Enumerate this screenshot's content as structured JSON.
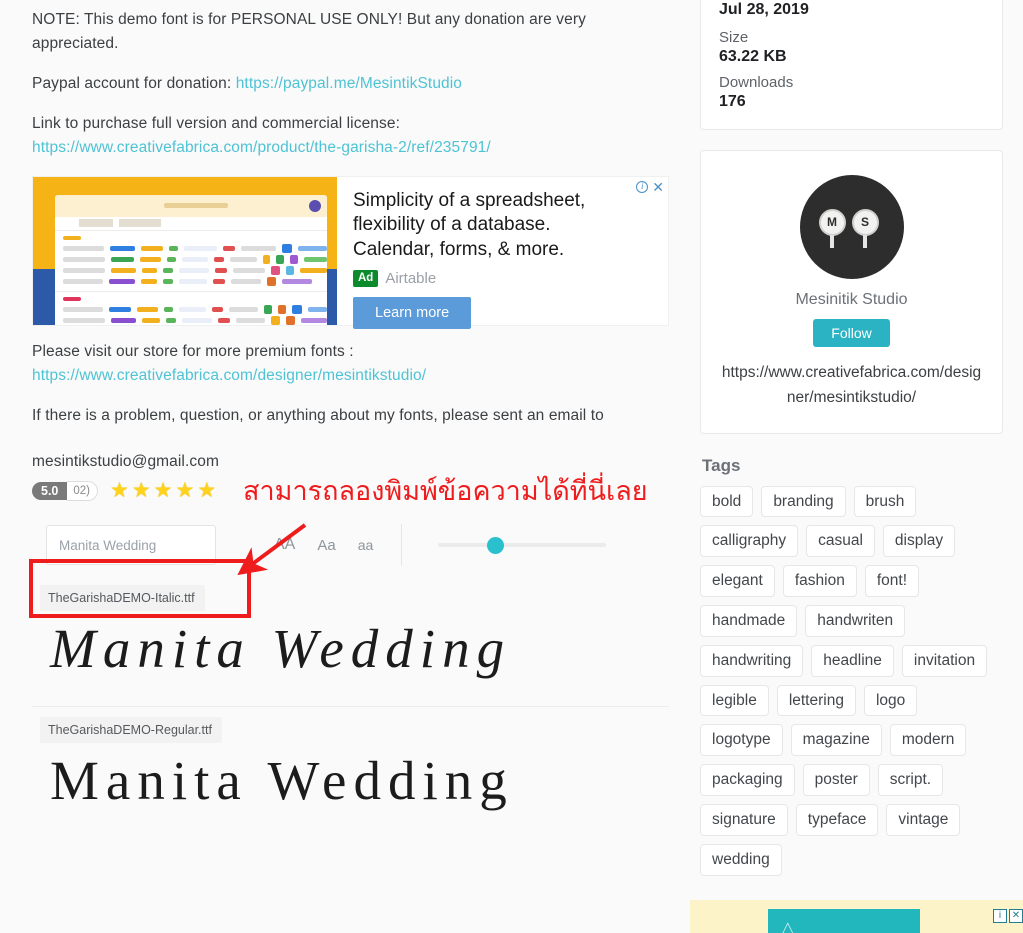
{
  "description": {
    "note": "NOTE: This demo font is for PERSONAL USE ONLY! But any donation are very appreciated.",
    "paypal_label": "Paypal account for donation: ",
    "paypal_link": "https://paypal.me/MesintikStudio",
    "purchase_label": "Link to purchase full version and commercial license:",
    "purchase_link": "https://www.creativefabrica.com/product/the-garisha-2/ref/235791/",
    "store_label": "Please visit our store for more premium fonts :",
    "store_link": "https://www.creativefabrica.com/designer/mesintikstudio/",
    "contact_label": "If there is a problem, question, or anything about my fonts, please sent an email to",
    "contact_email": "mesintikstudio@gmail.com"
  },
  "ad": {
    "headline": "Simplicity of a spreadsheet, flexibility of a database. Calendar, forms, & more.",
    "badge": "Ad",
    "advertiser": "Airtable",
    "cta": "Learn more",
    "info_icon": "i",
    "close_icon": "✕"
  },
  "rating": {
    "score": "5.0",
    "count": "02)",
    "stars": [
      "★",
      "★",
      "★",
      "★",
      "★"
    ]
  },
  "annotation": {
    "text": "สามารถลองพิมพ์ข้อความได้ที่นี่เลย",
    "color": "#ee1c1c"
  },
  "preview_toolbar": {
    "input_value": "Manita Wedding",
    "input_placeholder": "Manita Wedding",
    "size_large": "AA",
    "size_medium": "Aa",
    "size_small": "aa",
    "slider_position": "34"
  },
  "fonts": [
    {
      "name": "TheGarishaDEMO-Italic.ttf",
      "sample": "Manita Wedding"
    },
    {
      "name": "TheGarishaDEMO-Regular.ttf",
      "sample": "Manita Wedding"
    }
  ],
  "sidebar": {
    "meta": {
      "date_value": "Jul 28, 2019",
      "size_label": "Size",
      "size_value": "63.22 KB",
      "downloads_label": "Downloads",
      "downloads_value": "176"
    },
    "author": {
      "avatar_left": "M",
      "avatar_right": "S",
      "name": "Mesinitik Studio",
      "follow_label": "Follow",
      "url": "https://www.creativefabrica.com/designer/mesintikstudio/"
    },
    "tags_title": "Tags",
    "tags": [
      "bold",
      "branding",
      "brush",
      "calligraphy",
      "casual",
      "display",
      "elegant",
      "fashion",
      "font!",
      "handmade",
      "handwriten",
      "handwriting",
      "headline",
      "invitation",
      "legible",
      "lettering",
      "logo",
      "logotype",
      "magazine",
      "modern",
      "packaging",
      "poster",
      "script.",
      "signature",
      "typeface",
      "vintage",
      "wedding"
    ]
  },
  "bottom_ad": {
    "info_icon": "i",
    "close_icon": "✕"
  },
  "colors": {
    "link": "#4ec3d4",
    "accent_teal": "#2bb3c4",
    "slider_teal": "#2bc0cd",
    "annotation_red": "#ee1c1c",
    "star_yellow": "#ffd21e",
    "ad_cta_blue": "#5b9bd9",
    "ad_badge_green": "#0c8b2c"
  }
}
